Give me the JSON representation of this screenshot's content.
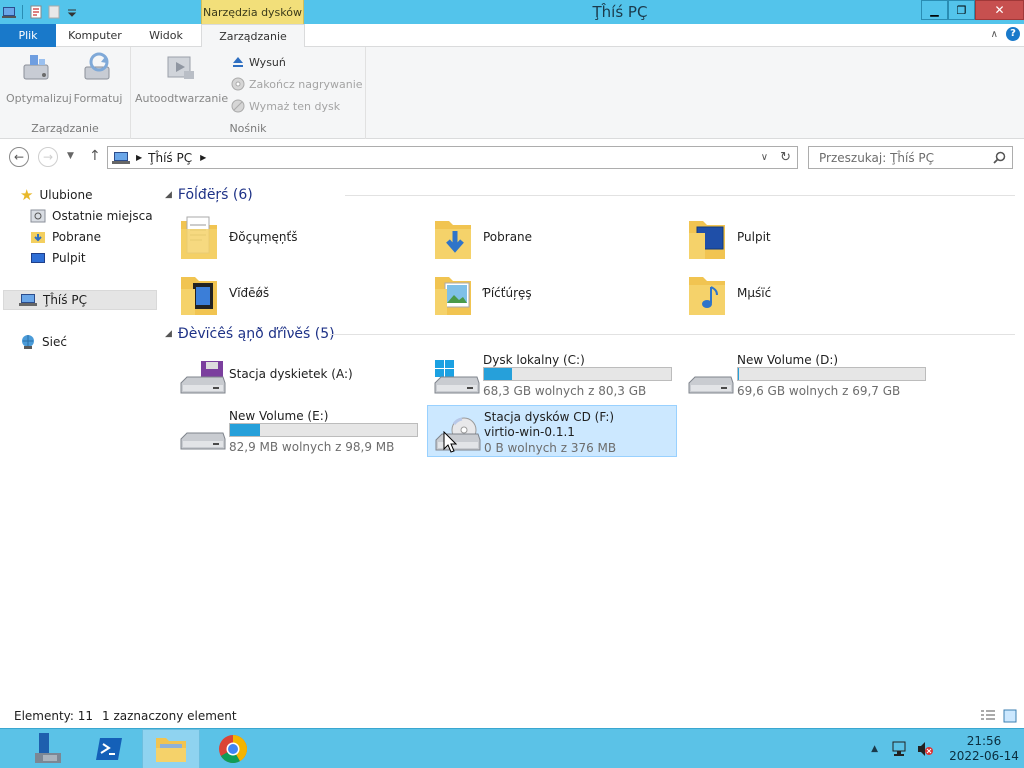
{
  "window": {
    "title": "Ţĥíś PÇ",
    "context_tab_group": "Narzędzia dysków"
  },
  "ribbon": {
    "tabs": [
      "Plik",
      "Komputer",
      "Widok",
      "Zarządzanie"
    ],
    "groups": {
      "zarzadzanie": {
        "label": "Zarządzanie",
        "buttons": [
          "Optymalizuj",
          "Formatuj"
        ]
      },
      "nosnik": {
        "label": "Nośnik",
        "big_button": "Autoodtwarzanie",
        "small_buttons": [
          "Wysuń",
          "Zakończ nagrywanie",
          "Wymaż ten dysk"
        ]
      }
    }
  },
  "address_bar": {
    "path": "Ţĥíś PÇ",
    "search_placeholder": "Przeszukaj: Ţĥíś PÇ"
  },
  "nav_pane": {
    "favorites": "Ulubione",
    "favorite_items": [
      "Ostatnie miejsca",
      "Pobrane",
      "Pulpit"
    ],
    "this_pc": "Ţĥíś PÇ",
    "network": "Sieć"
  },
  "content": {
    "folders_header": "Fōĺđëŗś (6)",
    "folders": [
      "Ðŏçųṃęņťš",
      "Pobrane",
      "Pulpit",
      "Vĭđēǿš",
      "Ƥíćťúŗȩş",
      "Mµśïć"
    ],
    "devices_header": "Ðèvïċêś ąņð ďŕîνěś (5)",
    "devices": [
      {
        "name": "Stacja dyskietek (A:)"
      },
      {
        "name": "Dysk lokalny (C:)",
        "info": "68,3 GB wolnych z 80,3 GB",
        "used_fraction": 0.15
      },
      {
        "name": "New Volume (D:)",
        "info": "69,6 GB wolnych z 69,7 GB",
        "used_fraction": 0.002
      },
      {
        "name": "New Volume (E:)",
        "info": "82,9 MB wolnych z 98,9 MB",
        "used_fraction": 0.16
      },
      {
        "name": "Stacja dysków CD (F:)",
        "label": "virtio-win-0.1.1",
        "info": "0 B wolnych z 376 MB"
      }
    ]
  },
  "status": {
    "items": "Elementy: 11",
    "selected": "1 zaznaczony element"
  },
  "taskbar": {
    "time": "21:56",
    "date": "2022-06-14"
  },
  "colors": {
    "accent": "#1979ca",
    "titlebar": "#53c4eb",
    "taskbar": "#5bc2e7",
    "bar_fill": "#26a0da",
    "selection": "#cce8ff"
  }
}
